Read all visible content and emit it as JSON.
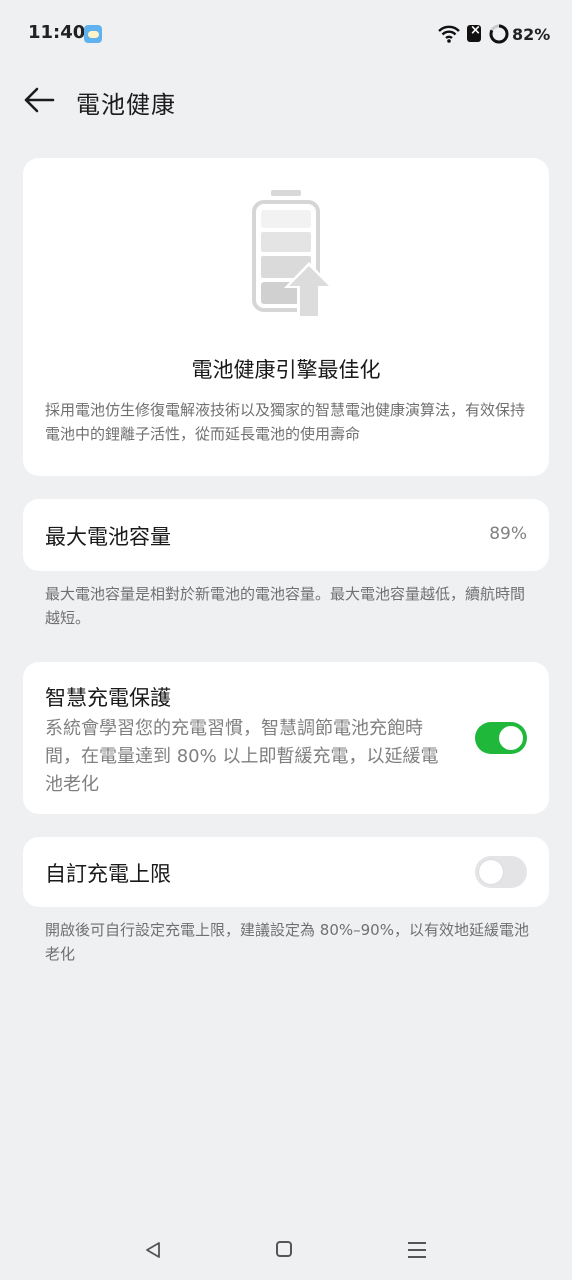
{
  "status_bar": {
    "time": "11:40",
    "battery_percent": "82%",
    "battery_level": 0.82,
    "icons": [
      "weather-icon",
      "wifi-icon",
      "sim-icon",
      "battery-ring-icon"
    ]
  },
  "header": {
    "title": "電池健康"
  },
  "hero": {
    "title": "電池健康引擎最佳化",
    "description": "採用電池仿生修復電解液技術以及獨家的智慧電池健康演算法，有效保持電池中的鋰離子活性，從而延長電池的使用壽命"
  },
  "capacity": {
    "label": "最大電池容量",
    "value": "89%",
    "note": "最大電池容量是相對於新電池的電池容量。最大電池容量越低，續航時間越短。"
  },
  "smart_charging": {
    "label": "智慧充電保護",
    "description": "系統會學習您的充電習慣，智慧調節電池充飽時間，在電量達到 80% 以上即暫緩充電，以延緩電池老化",
    "enabled": true
  },
  "charge_limit": {
    "label": "自訂充電上限",
    "enabled": false,
    "note": "開啟後可自行設定充電上限，建議設定為 80%–90%，以有效地延緩電池老化"
  },
  "colors": {
    "background": "#eff0f2",
    "card": "#ffffff",
    "switch_on": "#1fb83b",
    "switch_off": "#e4e4e6"
  },
  "nav": {
    "icons": [
      "nav-back-icon",
      "nav-home-icon",
      "nav-menu-icon"
    ]
  }
}
